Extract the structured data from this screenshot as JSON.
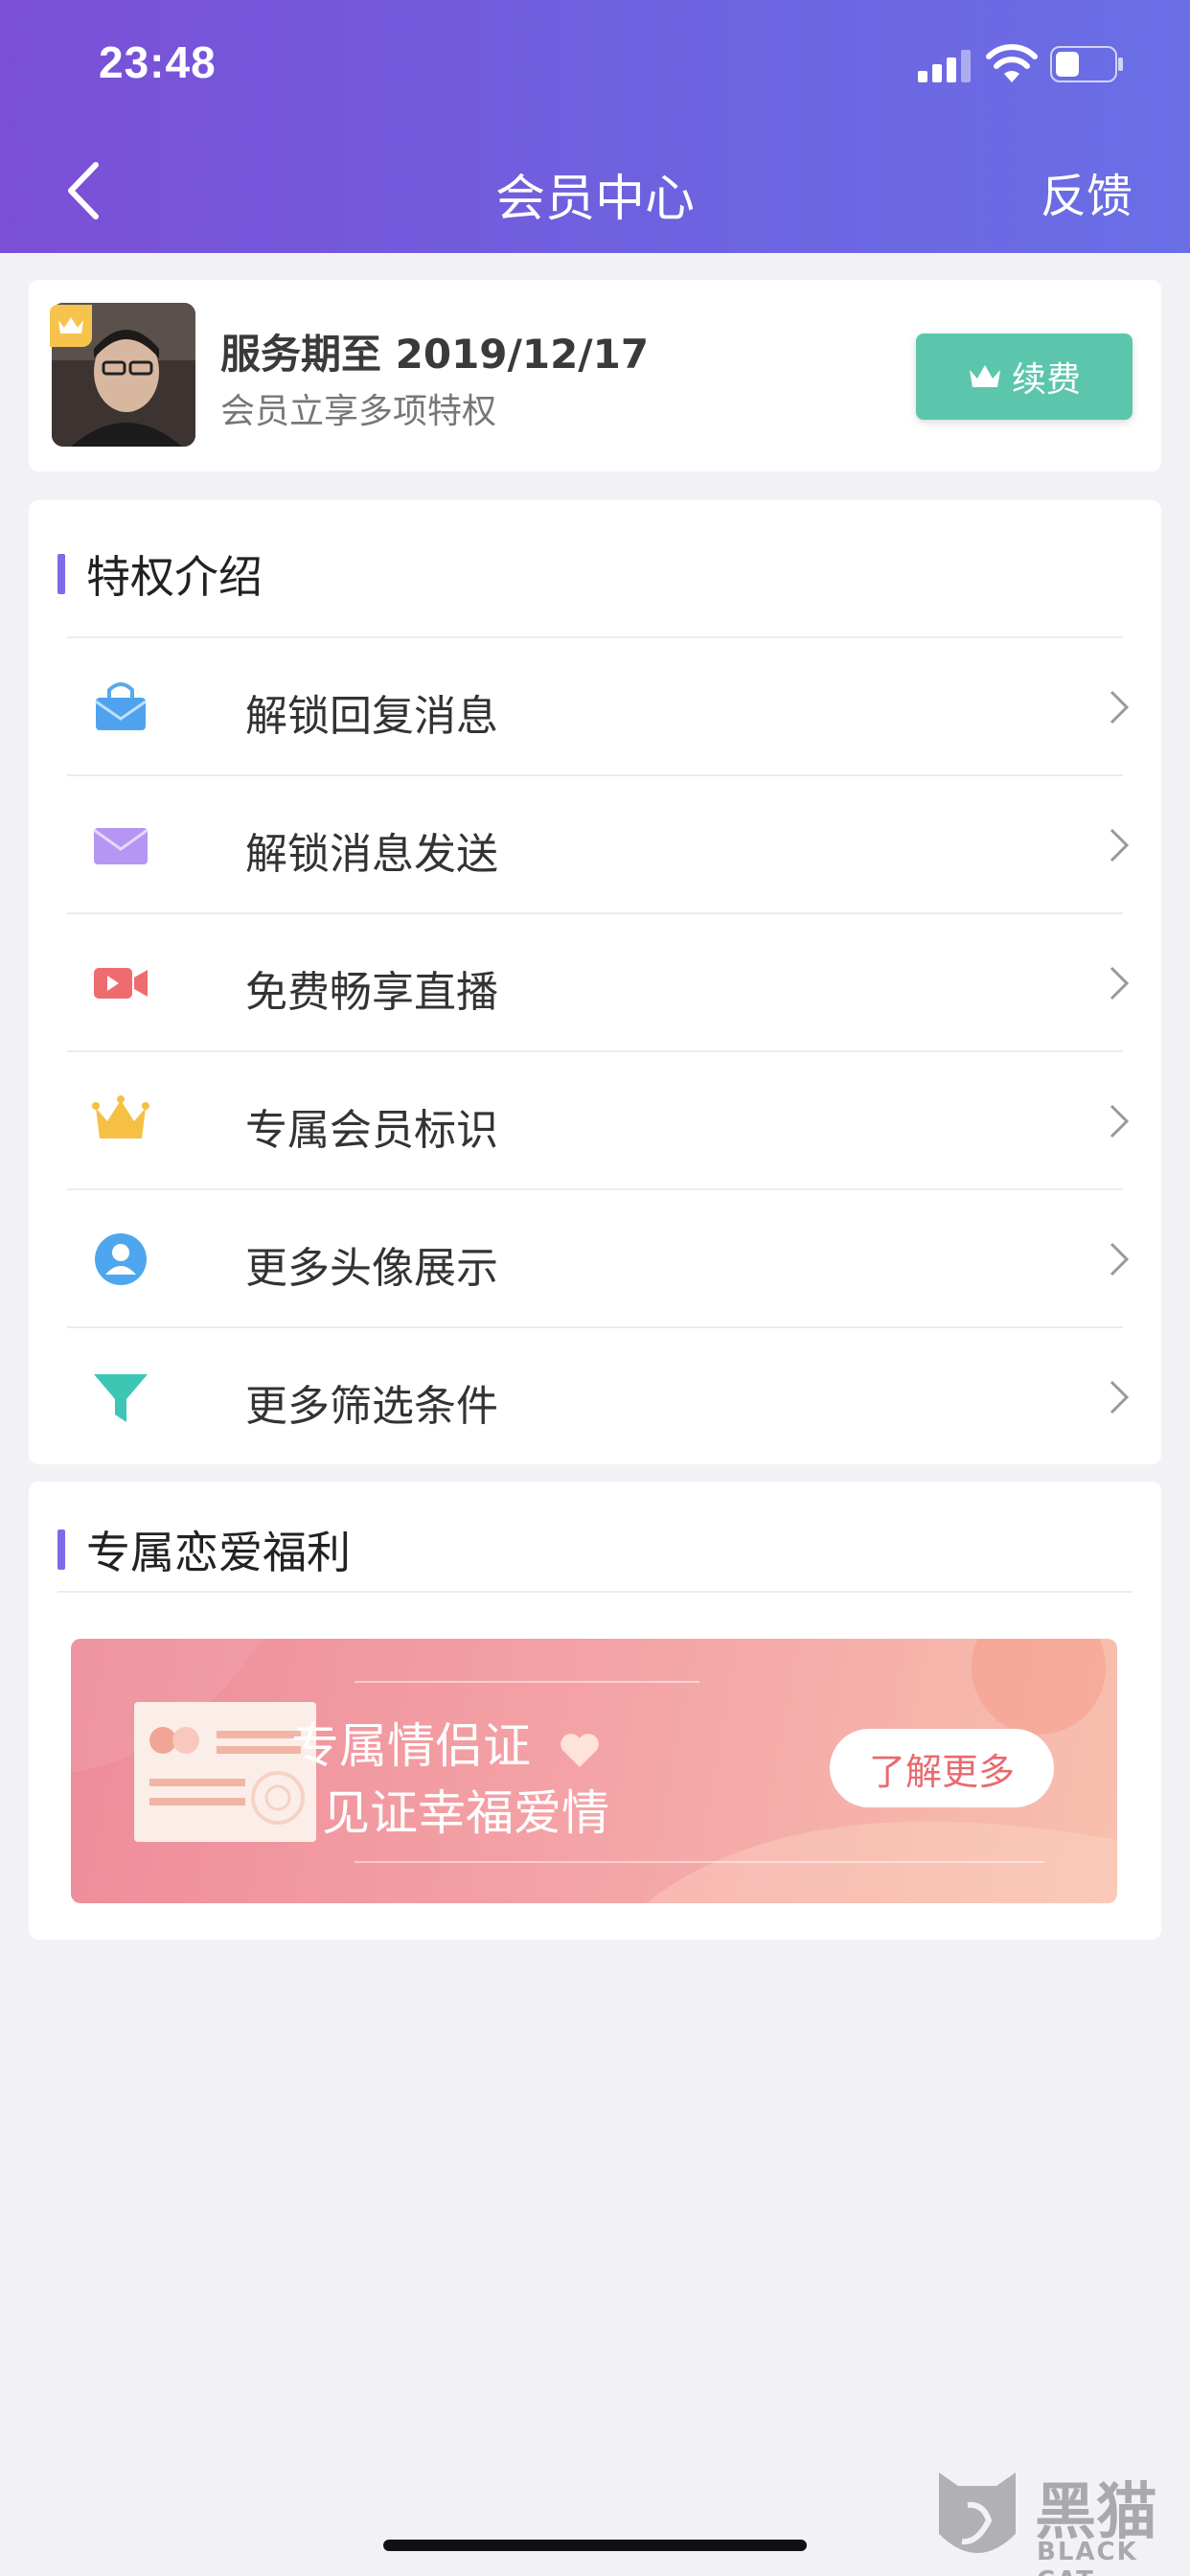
{
  "status": {
    "time": "23:48"
  },
  "nav": {
    "title": "会员中心",
    "feedback": "反馈"
  },
  "member": {
    "service_until": "服务期至 2019/12/17",
    "subtitle": "会员立享多项特权",
    "renew_label": "续费"
  },
  "privileges": {
    "heading": "特权介绍",
    "items": [
      {
        "label": "解锁回复消息",
        "icon": "mail-open-icon"
      },
      {
        "label": "解锁消息发送",
        "icon": "envelope-icon"
      },
      {
        "label": "免费畅享直播",
        "icon": "video-camera-icon"
      },
      {
        "label": "专属会员标识",
        "icon": "crown-icon"
      },
      {
        "label": "更多头像展示",
        "icon": "user-avatar-icon"
      },
      {
        "label": "更多筛选条件",
        "icon": "filter-icon"
      }
    ]
  },
  "love": {
    "heading": "专属恋爱福利",
    "banner_line1": "专属情侣证",
    "banner_line2": "见证幸福爱情",
    "banner_button": "了解更多"
  },
  "watermark": {
    "cn": "黑猫",
    "en": "BLACK CAT"
  },
  "colors": {
    "accent": "#7d6be7",
    "renew": "#5cc6ad",
    "banner_text": "#e86a6f"
  }
}
